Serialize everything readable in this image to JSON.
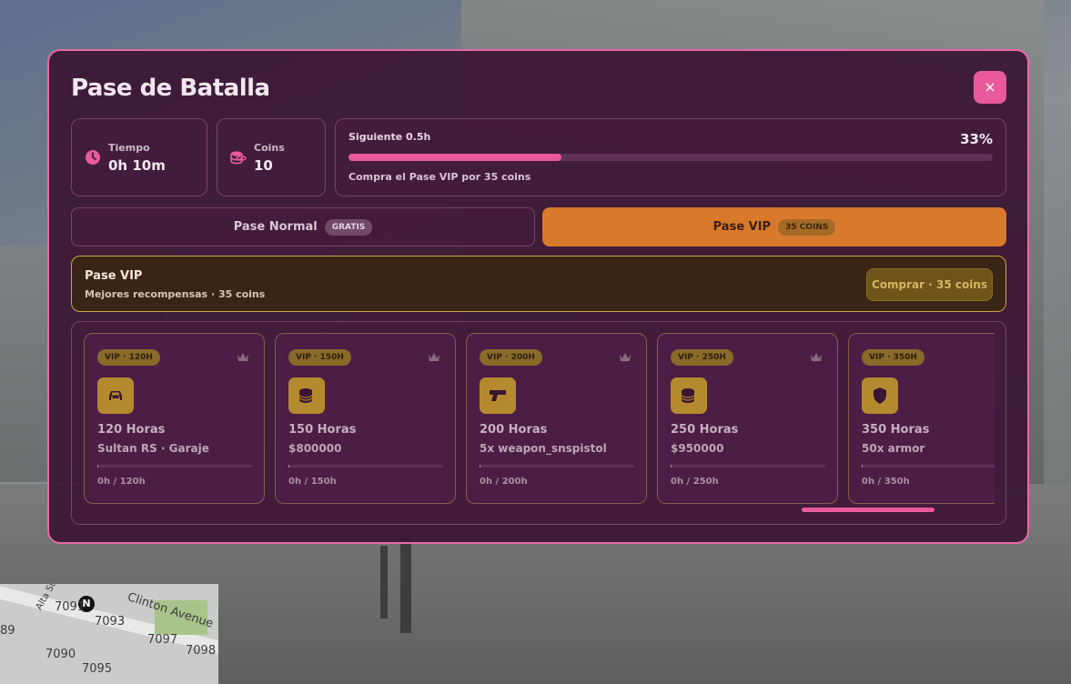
{
  "panel": {
    "title": "Pase de Batalla",
    "close_label": "×"
  },
  "stats": {
    "time": {
      "label": "Tiempo",
      "value": "0h 10m"
    },
    "coins": {
      "label": "Coins",
      "value": "10"
    },
    "progress": {
      "next_label": "Siguiente 0.5h",
      "percent_label": "33%",
      "percent": 33,
      "hint": "Compra el Pase VIP por 35 coins"
    }
  },
  "tabs": {
    "normal": {
      "label": "Pase Normal",
      "badge": "GRATIS"
    },
    "vip": {
      "label": "Pase VIP",
      "badge": "35 COINS"
    }
  },
  "banner": {
    "title": "Pase VIP",
    "subtitle": "Mejores recompensas · 35 coins",
    "buy_label": "Comprar · 35 coins"
  },
  "rewards": [
    {
      "tier": "VIP · 120H",
      "icon": "car-icon",
      "hours": "120 Horas",
      "item": "Sultan RS · Garaje",
      "progress": "0h / 120h"
    },
    {
      "tier": "VIP · 150H",
      "icon": "coins-icon",
      "hours": "150 Horas",
      "item": "$800000",
      "progress": "0h / 150h"
    },
    {
      "tier": "VIP · 200H",
      "icon": "pistol-icon",
      "hours": "200 Horas",
      "item": "5x weapon_snspistol",
      "progress": "0h / 200h"
    },
    {
      "tier": "VIP · 250H",
      "icon": "coins-icon",
      "hours": "250 Horas",
      "item": "$950000",
      "progress": "0h / 250h"
    },
    {
      "tier": "VIP · 350H",
      "icon": "shield-icon",
      "hours": "350 Horas",
      "item": "50x armor",
      "progress": "0h / 350h"
    }
  ],
  "minimap": {
    "street": "Clinton Avenue",
    "street2": "Alta St",
    "north": "N",
    "numbers": [
      "7091",
      "7093",
      "7097",
      "7098",
      "7095",
      "7090",
      "89"
    ]
  },
  "colors": {
    "accent": "#e85a9c",
    "vip": "#d9792b",
    "gold": "#b58a2e",
    "panel_bg": "#3a1634"
  }
}
